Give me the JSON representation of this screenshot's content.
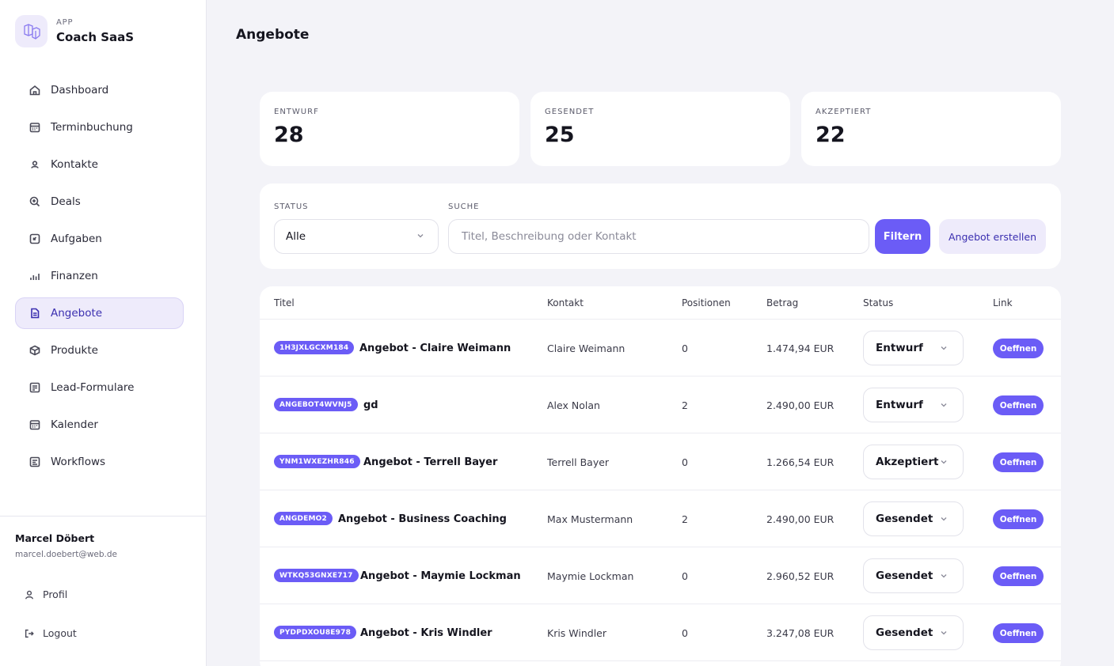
{
  "brand": {
    "app_label": "APP",
    "name": "Coach SaaS"
  },
  "nav": [
    {
      "label": "Dashboard",
      "icon": "home-icon"
    },
    {
      "label": "Terminbuchung",
      "icon": "calendar-icon"
    },
    {
      "label": "Kontakte",
      "icon": "user-icon"
    },
    {
      "label": "Deals",
      "icon": "search-plus-icon"
    },
    {
      "label": "Aufgaben",
      "icon": "task-icon"
    },
    {
      "label": "Finanzen",
      "icon": "bar-chart-icon"
    },
    {
      "label": "Angebote",
      "icon": "document-icon",
      "active": true
    },
    {
      "label": "Produkte",
      "icon": "box-icon"
    },
    {
      "label": "Lead-Formulare",
      "icon": "form-icon"
    },
    {
      "label": "Kalender",
      "icon": "calendar-icon"
    },
    {
      "label": "Workflows",
      "icon": "workflow-icon"
    }
  ],
  "user": {
    "name": "Marcel Döbert",
    "email": "marcel.doebert@web.de"
  },
  "side_links": {
    "profile": "Profil",
    "logout": "Logout"
  },
  "page": {
    "title": "Angebote"
  },
  "stats": [
    {
      "label": "ENTWURF",
      "value": "28"
    },
    {
      "label": "GESENDET",
      "value": "25"
    },
    {
      "label": "AKZEPTIERT",
      "value": "22"
    }
  ],
  "filters": {
    "status_label": "STATUS",
    "status_value": "Alle",
    "search_label": "SUCHE",
    "search_placeholder": "Titel, Beschreibung oder Kontakt",
    "filter_button": "Filtern",
    "create_button": "Angebot erstellen"
  },
  "table": {
    "headers": {
      "title": "Titel",
      "contact": "Kontakt",
      "positions": "Positionen",
      "amount": "Betrag",
      "status": "Status",
      "link": "Link"
    },
    "open_label": "Oeffnen",
    "rows": [
      {
        "code": "1H3JXLGCXM184",
        "title": "Angebot - Claire Weimann",
        "contact": "Claire Weimann",
        "positions": "0",
        "amount": "1.474,94 EUR",
        "status": "Entwurf"
      },
      {
        "code": "ANGEBOT4WVNJ5",
        "title": "gd",
        "contact": "Alex Nolan",
        "positions": "2",
        "amount": "2.490,00 EUR",
        "status": "Entwurf"
      },
      {
        "code": "YNM1WXEZHR846",
        "title": "Angebot - Terrell Bayer",
        "contact": "Terrell Bayer",
        "positions": "0",
        "amount": "1.266,54 EUR",
        "status": "Akzeptiert"
      },
      {
        "code": "ANGDEMO2",
        "title": "Angebot - Business Coaching",
        "contact": "Max Mustermann",
        "positions": "2",
        "amount": "2.490,00 EUR",
        "status": "Gesendet"
      },
      {
        "code": "WTKQ53GNXE717",
        "title": "Angebot - Maymie Lockman",
        "contact": "Maymie Lockman",
        "positions": "0",
        "amount": "2.960,52 EUR",
        "status": "Gesendet"
      },
      {
        "code": "PYDPDXOU8E978",
        "title": "Angebot - Kris Windler",
        "contact": "Kris Windler",
        "positions": "0",
        "amount": "3.247,08 EUR",
        "status": "Gesendet"
      }
    ]
  },
  "colors": {
    "accent": "#6b5cf6",
    "accent_soft": "#eeebfb",
    "background": "#f3f3f8"
  }
}
